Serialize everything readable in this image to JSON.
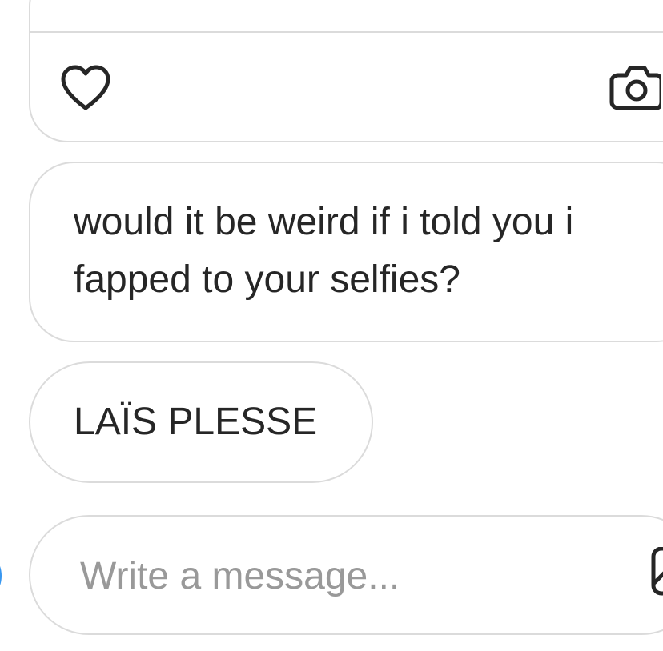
{
  "thread": {
    "messages": [
      {
        "lines": [
          "would it be weird if i told you i",
          "fapped to your selfies?"
        ]
      },
      {
        "text": "LAÏS PLESSE"
      }
    ]
  },
  "actions": {
    "like_icon": "heart-outline",
    "camera_icon": "camera-outline"
  },
  "composer": {
    "placeholder": "Write a message...",
    "value": "",
    "gallery_icon": "image-outline"
  },
  "colors": {
    "border": "#dbdbdb",
    "text": "#262626",
    "placeholder": "#999999",
    "accent": "#3897f0"
  }
}
